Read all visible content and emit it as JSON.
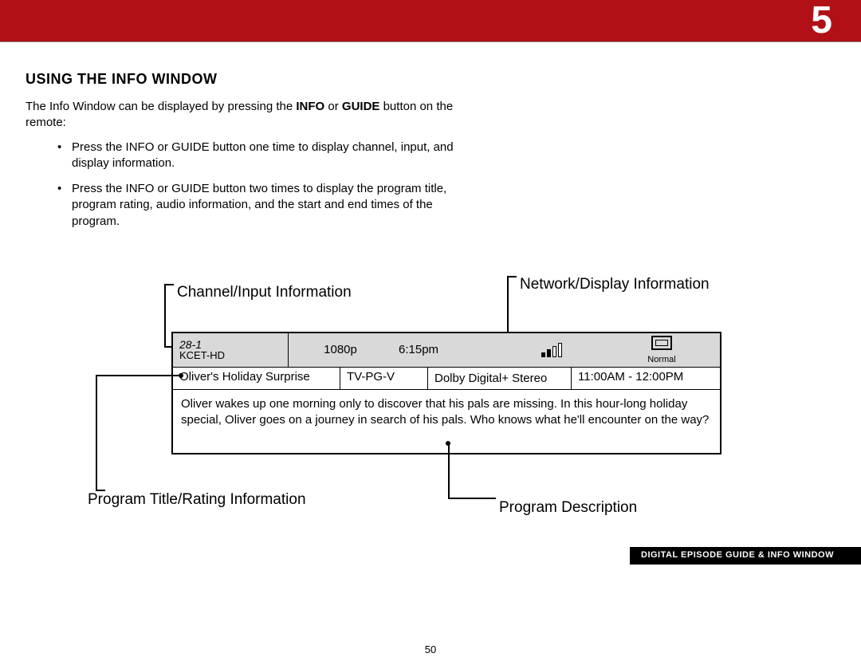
{
  "chapter_number": "5",
  "section_title": "Using the Info Window",
  "intro": {
    "line1_pre": "The Info Window can be displayed by pressing the ",
    "bold1": "INFO",
    "mid": " or ",
    "bold2": "GUIDE",
    "line1_post": " button on the remote:"
  },
  "bullets": [
    {
      "pre": "Press the ",
      "b1": "INFO",
      "mid": " or ",
      "b2": "GUIDE",
      "post": " button one time to display channel, input, and display information."
    },
    {
      "pre": "Press the ",
      "b1": "INFO",
      "mid": " or ",
      "b2": "GUIDE",
      "post": " button two times to display the program title, program rating, audio information, and the start and end times of the program."
    }
  ],
  "callouts": {
    "channel_input": "Channel/Input Information",
    "network_display": "Network/Display Information",
    "program_title_rating": "Program Title/Rating Information",
    "program_description": "Program Description"
  },
  "info_window": {
    "channel_number": "28-1",
    "channel_name": "KCET-HD",
    "resolution": "1080p",
    "current_time": "6:15pm",
    "signal_bars_filled": 2,
    "display_mode": "Normal",
    "program_title": "Oliver's Holiday Surprise",
    "rating": "TV-PG-V",
    "audio": "Dolby Digital+ Stereo",
    "time_range": "11:00AM - 12:00PM",
    "description": "Oliver wakes up one morning only to discover that his pals are missing. In this hour-long holiday special, Oliver goes on a journey in search of his pals. Who knows what he'll encounter on the way?"
  },
  "footer_label": "Digital Episode Guide & Info Window",
  "page_number": "50"
}
